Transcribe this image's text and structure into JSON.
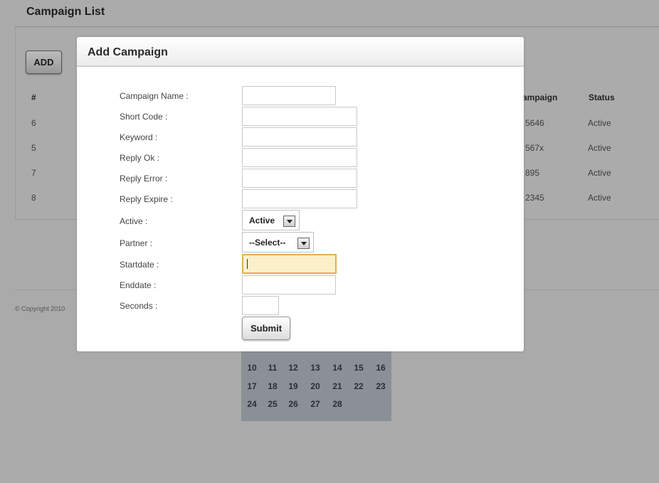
{
  "page": {
    "title": "Campaign List",
    "add_label": "ADD",
    "footer": "© Copyright 2010"
  },
  "table": {
    "headers": {
      "id": "#",
      "campaign": "ampaign",
      "status": "Status"
    },
    "rows": [
      {
        "id": "6",
        "campaign": "5646",
        "status": "Active"
      },
      {
        "id": "5",
        "campaign": "567x",
        "status": "Active"
      },
      {
        "id": "7",
        "campaign": "895",
        "status": "Active"
      },
      {
        "id": "8",
        "campaign": "2345",
        "status": "Active"
      }
    ]
  },
  "calendar": {
    "weeks": [
      [
        "10",
        "11",
        "12",
        "13",
        "14",
        "15",
        "16"
      ],
      [
        "17",
        "18",
        "19",
        "20",
        "21",
        "22",
        "23"
      ],
      [
        "24",
        "25",
        "26",
        "27",
        "28"
      ]
    ]
  },
  "modal": {
    "title": "Add Campaign",
    "fields": {
      "campaign_name": {
        "label": "Campaign Name :",
        "value": ""
      },
      "short_code": {
        "label": "Short Code :",
        "value": ""
      },
      "keyword": {
        "label": "Keyword :",
        "value": ""
      },
      "reply_ok": {
        "label": "Reply Ok :",
        "value": ""
      },
      "reply_error": {
        "label": "Reply Error :",
        "value": ""
      },
      "reply_expire": {
        "label": "Reply Expire :",
        "value": ""
      },
      "active": {
        "label": "Active :",
        "selected": "Active"
      },
      "partner": {
        "label": "Partner :",
        "selected": "--Select--"
      },
      "startdate": {
        "label": "Startdate :",
        "value": ""
      },
      "enddate": {
        "label": "Enddate :",
        "value": ""
      },
      "seconds": {
        "label": "Seconds :",
        "value": ""
      }
    },
    "submit_label": "Submit"
  },
  "colors": {
    "overlay": "#aaaaaa",
    "calendar_bg": "#8b9097",
    "focus_border": "#e0b050",
    "focus_bg": "#fdf0c8"
  }
}
